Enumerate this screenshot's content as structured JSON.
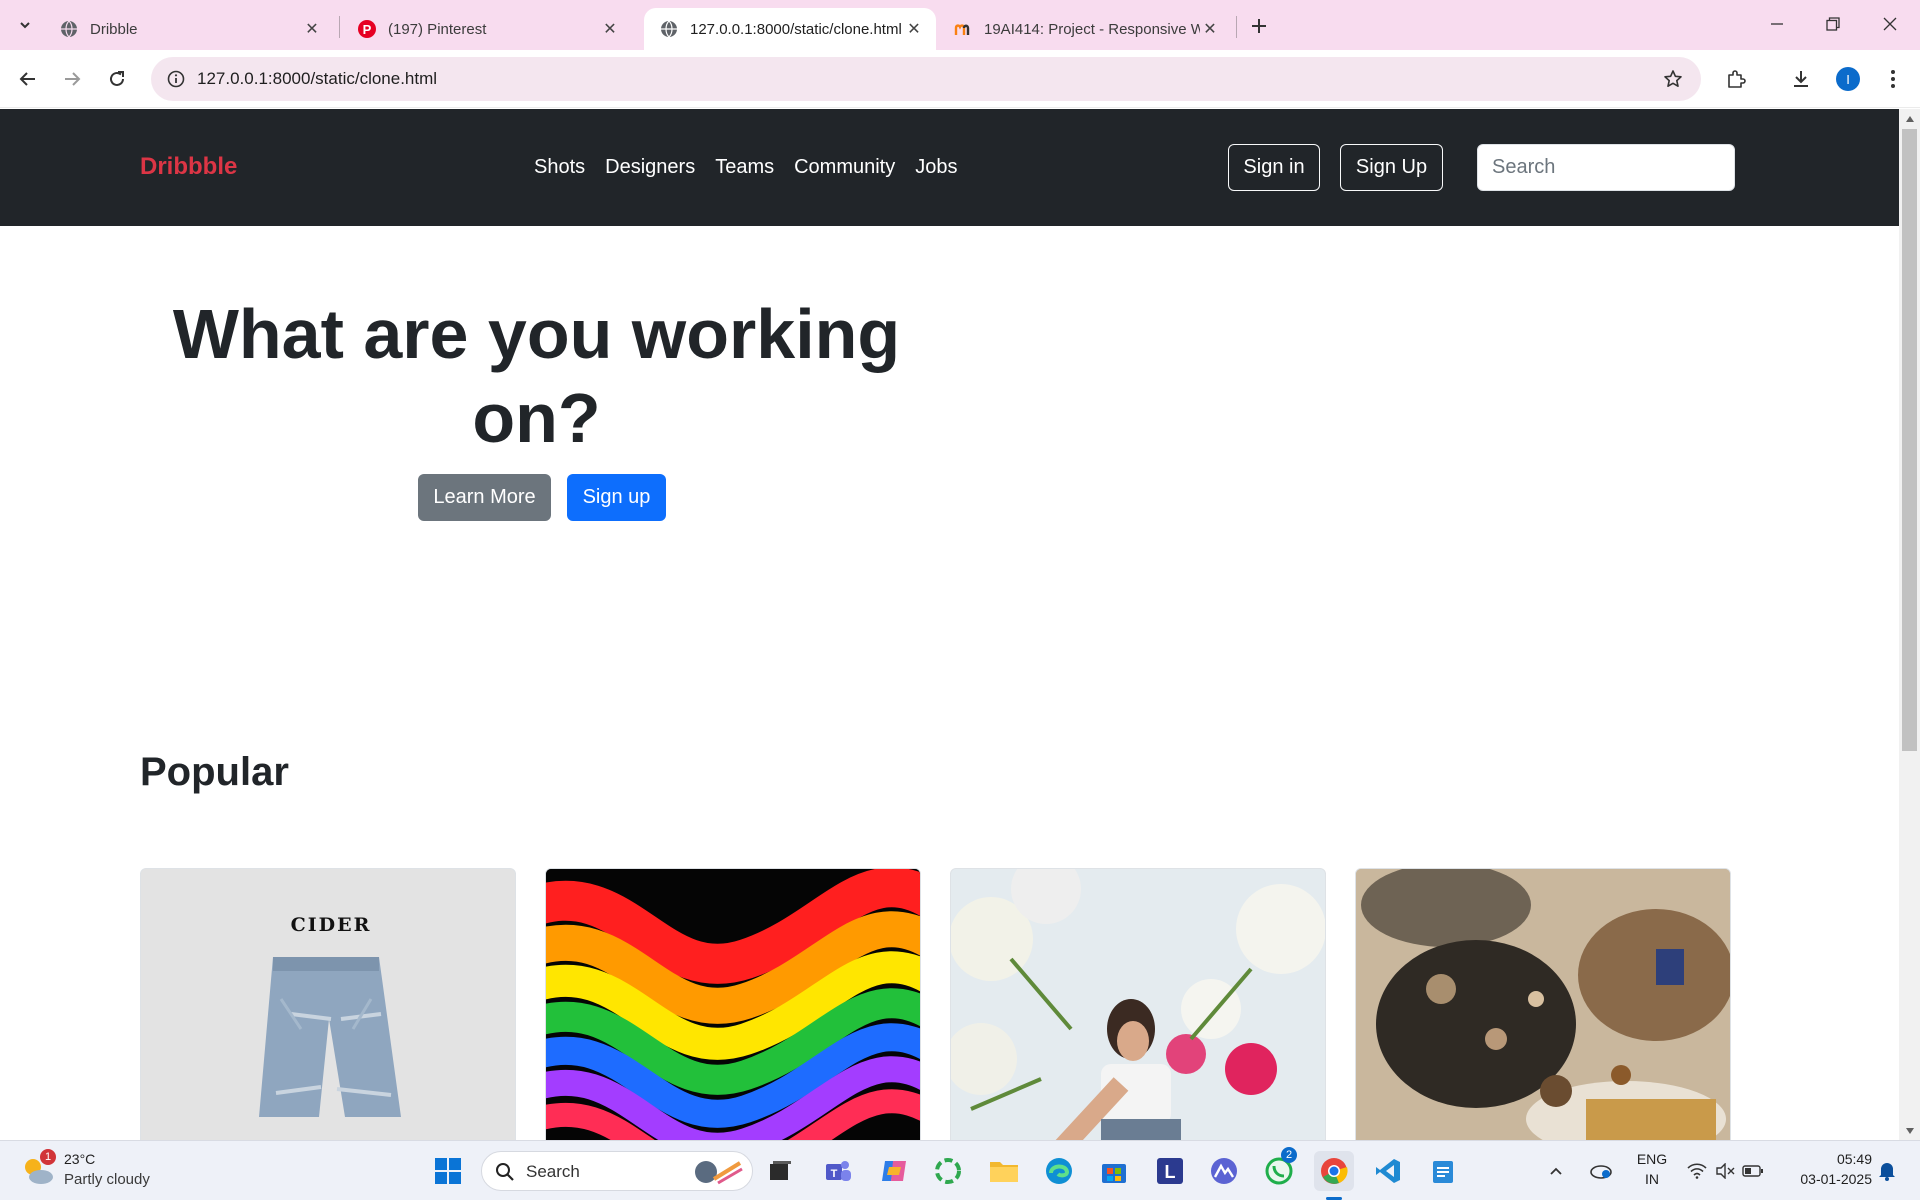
{
  "browser": {
    "tabs": [
      {
        "title": "Dribble",
        "active": false
      },
      {
        "title": "(197) Pinterest",
        "active": false
      },
      {
        "title": "127.0.0.1:8000/static/clone.html",
        "active": true
      },
      {
        "title": "19AI414: Project - Responsive W",
        "active": false
      }
    ],
    "url": "127.0.0.1:8000/static/clone.html",
    "profile_initial": "I"
  },
  "site": {
    "brand": "Dribbble",
    "nav": [
      "Shots",
      "Designers",
      "Teams",
      "Community",
      "Jobs"
    ],
    "sign_in": "Sign in",
    "sign_up": "Sign Up",
    "search_placeholder": "Search",
    "hero_title": "What are you working on?",
    "learn_more": "Learn More",
    "hero_signup": "Sign up",
    "popular_heading": "Popular",
    "card_1_brand": "CIDER"
  },
  "taskbar": {
    "weather_badge": "1",
    "temperature": "23°C",
    "weather_desc": "Partly cloudy",
    "search_label": "Search",
    "whatsapp_badge": "2",
    "language": "ENG",
    "region": "IN",
    "time": "05:49",
    "date": "03-01-2025"
  },
  "colors": {
    "brand_red": "#dc3545",
    "navbar_dark": "#212529",
    "primary_blue": "#0d6efd",
    "secondary_gray": "#6c757d",
    "tabstrip_pink": "#f8dcef"
  }
}
